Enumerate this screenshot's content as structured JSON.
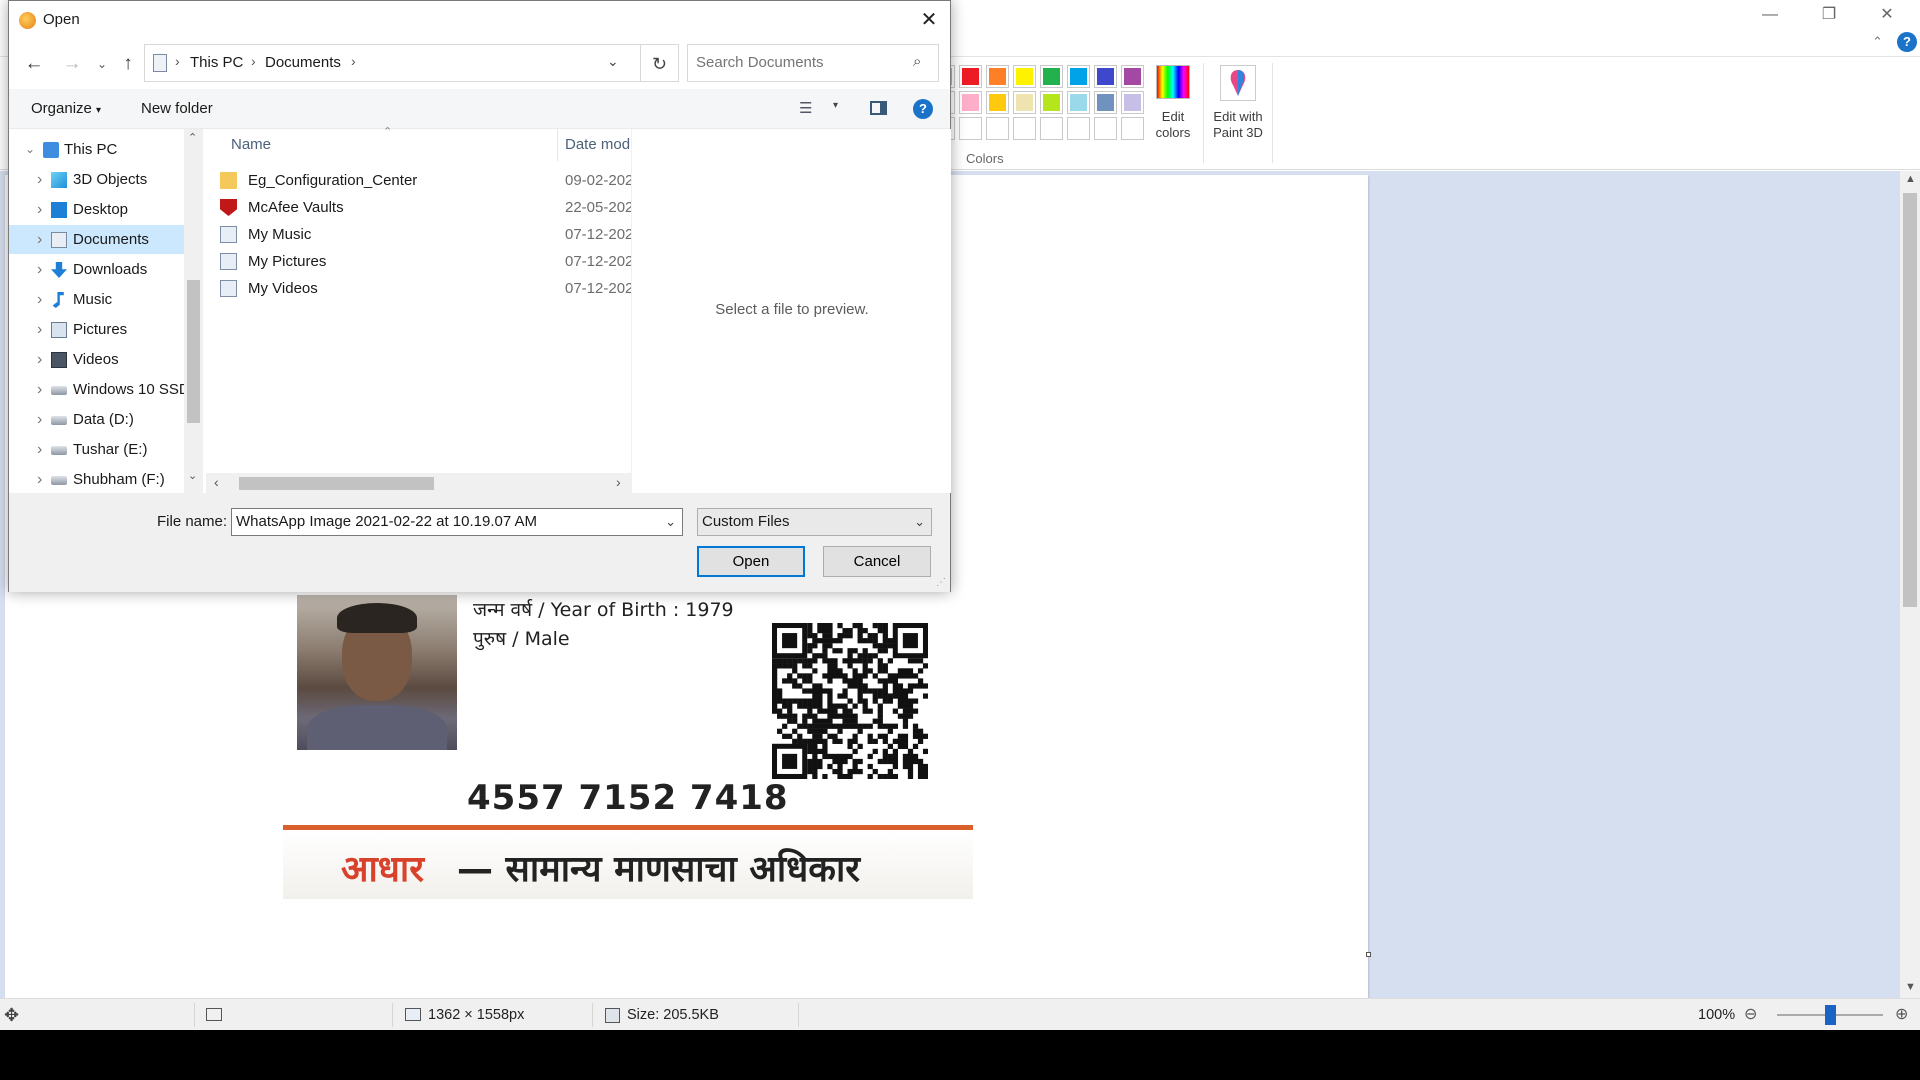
{
  "dialog": {
    "title": "Open",
    "address": {
      "crumbs": [
        "This PC",
        "Documents"
      ]
    },
    "search": {
      "placeholder": "Search Documents"
    },
    "toolbar": {
      "organize": "Organize",
      "new_folder": "New folder"
    },
    "nav_tree": [
      {
        "label": "This PC",
        "icon": "pc-icon",
        "level": 0,
        "expanded": true
      },
      {
        "label": "3D Objects",
        "icon": "3d-objects-icon",
        "level": 1
      },
      {
        "label": "Desktop",
        "icon": "desktop-icon",
        "level": 1
      },
      {
        "label": "Documents",
        "icon": "documents-icon",
        "level": 1,
        "selected": true
      },
      {
        "label": "Downloads",
        "icon": "downloads-icon",
        "level": 1
      },
      {
        "label": "Music",
        "icon": "music-icon",
        "level": 1
      },
      {
        "label": "Pictures",
        "icon": "pictures-icon",
        "level": 1
      },
      {
        "label": "Videos",
        "icon": "videos-icon",
        "level": 1
      },
      {
        "label": "Windows 10 SSD",
        "icon": "drive-icon",
        "level": 1
      },
      {
        "label": "Data (D:)",
        "icon": "drive-icon",
        "level": 1
      },
      {
        "label": "Tushar (E:)",
        "icon": "drive-icon",
        "level": 1
      },
      {
        "label": "Shubham (F:)",
        "icon": "drive-icon",
        "level": 1
      }
    ],
    "columns": {
      "name": "Name",
      "date": "Date mod"
    },
    "files": [
      {
        "name": "Eg_Configuration_Center",
        "date": "09-02-202",
        "icon": "folder-icon"
      },
      {
        "name": "McAfee Vaults",
        "date": "22-05-202",
        "icon": "mcafee-icon"
      },
      {
        "name": "My Music",
        "date": "07-12-202",
        "icon": "music-shortcut-icon"
      },
      {
        "name": "My Pictures",
        "date": "07-12-202",
        "icon": "pictures-shortcut-icon"
      },
      {
        "name": "My Videos",
        "date": "07-12-202",
        "icon": "videos-shortcut-icon"
      }
    ],
    "preview_text": "Select a file to preview.",
    "file_name_label": "File name:",
    "file_name_value": "WhatsApp Image 2021-02-22 at 10.19.07 AM",
    "file_type": "Custom Files",
    "open_label": "Open",
    "cancel_label": "Cancel",
    "accent_color": "#0078d7"
  },
  "paint": {
    "ribbon": {
      "colors_group_label": "Colors",
      "edit_colors_label": "Edit colors",
      "edit_paint3d_label": "Edit with Paint 3D",
      "palette_row1": [
        "#ed1c24",
        "#ff7f27",
        "#fff200",
        "#22b14c",
        "#00a2e8",
        "#3f48cc",
        "#a349a4"
      ],
      "palette_row2": [
        "#ffaec9",
        "#ffc90e",
        "#efe4b0",
        "#b5e61d",
        "#99d9ea",
        "#7092be",
        "#c8bfe7"
      ]
    },
    "image": {
      "birth_line": "जन्म वर्ष / Year of Birth : 1979",
      "gender_line": "पुरुष / Male",
      "aadhaar_number": "4557 7152 7418",
      "footer_red": "आधार",
      "footer_rest": "— सामान्य माणसाचा अधिकार"
    },
    "status": {
      "dimensions": "1362 × 1558px",
      "size": "Size: 205.5KB",
      "zoom": "100%"
    }
  }
}
